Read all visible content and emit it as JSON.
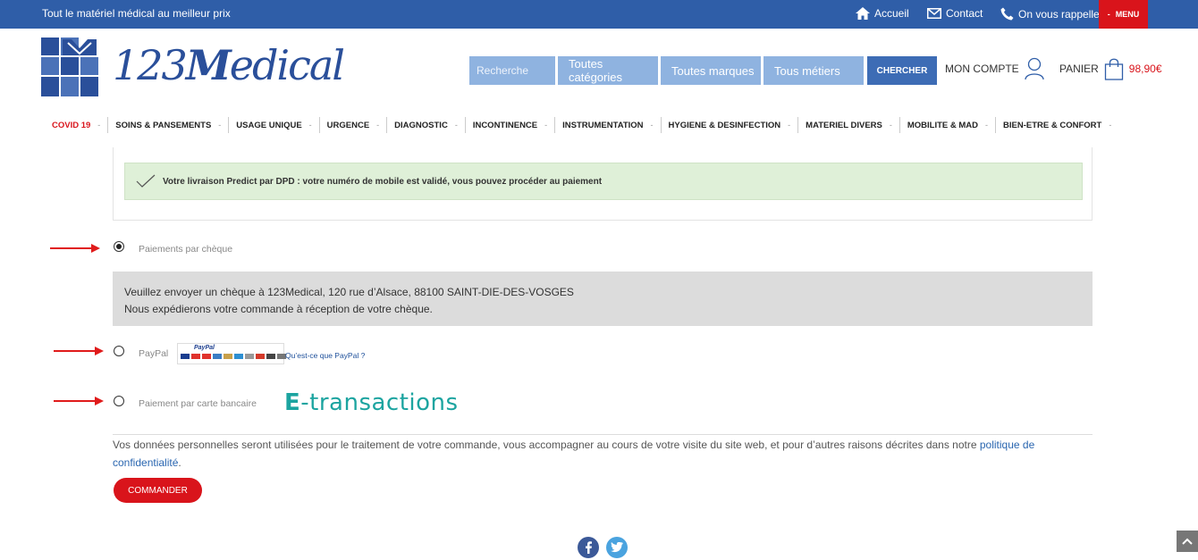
{
  "topbar": {
    "tagline": "Tout le matériel médical au meilleur prix",
    "links": [
      "Accueil",
      "Contact",
      "On vous rappelle"
    ],
    "menu_label": "MENU"
  },
  "logo": {
    "text_num": "123",
    "text_m": "M",
    "text_rest": "edical"
  },
  "search": {
    "placeholder": "Recherche",
    "categories": "Toutes catégories",
    "brands": "Toutes marques",
    "trades": "Tous métiers",
    "button": "CHERCHER"
  },
  "account": {
    "label": "MON COMPTE"
  },
  "cart": {
    "label": "PANIER",
    "total": "98,90€"
  },
  "nav": [
    "COVID 19",
    "SOINS & PANSEMENTS",
    "USAGE UNIQUE",
    "URGENCE",
    "DIAGNOSTIC",
    "INCONTINENCE",
    "INSTRUMENTATION",
    "HYGIENE & DESINFECTION",
    "MATERIEL DIVERS",
    "MOBILITE & MAD",
    "BIEN-ETRE & CONFORT"
  ],
  "success_msg": "Votre livraison Predict par DPD : votre numéro de mobile est validé, vous pouvez procéder au paiement",
  "payment": {
    "cheque_label": "Paiements par chèque",
    "cheque_line1": "Veuillez envoyer un chèque à 123Medical, 120 rue d’Alsace, 88100 SAINT-DIE-DES-VOSGES",
    "cheque_line2": "Nous expédierons votre commande à réception de votre chèque.",
    "paypal_label": "PayPal",
    "paypal_logo_text": "PayPal",
    "paypal_link": "Qu’est-ce que PayPal ?",
    "card_label": "Paiement par carte bancaire",
    "etrans_e": "E",
    "etrans_rest": "-transactions",
    "selected": "cheque"
  },
  "privacy": {
    "text": "Vos données personnelles seront utilisées pour le traitement de votre commande, vous accompagner au cours de votre visite du site web, et pour d’autres raisons décrites dans notre ",
    "link": "politique de confidentialité",
    "end": "."
  },
  "order_button": "COMMANDER",
  "colors": {
    "brand_blue": "#2f5ea8",
    "accent_red": "#d9141b",
    "search_blue": "#8fb3e0",
    "success_bg": "#dff0d8",
    "etrans_teal": "#1ca4a0"
  }
}
